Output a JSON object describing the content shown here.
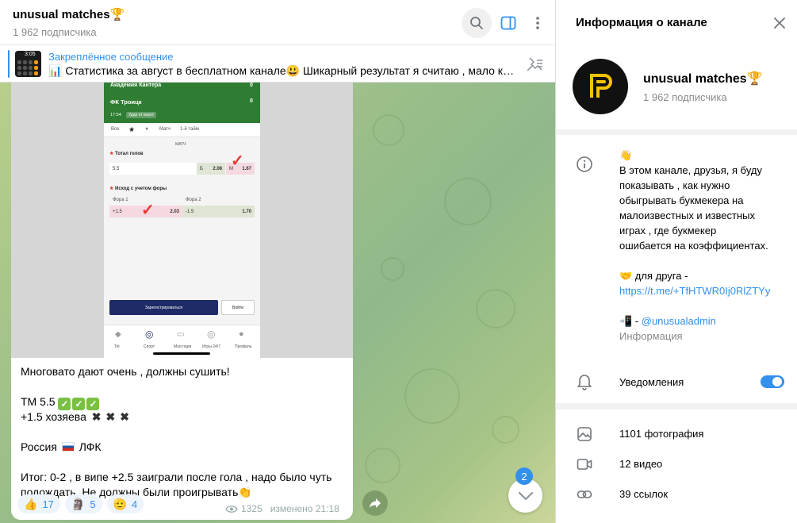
{
  "header": {
    "channel_title": "unusual matches🏆",
    "subscribers": "1 962 подписчика",
    "icons": [
      "search-icon",
      "sidebar-toggle-icon",
      "more-vertical-icon"
    ]
  },
  "pinned": {
    "title": "Закреплённое сообщение",
    "text": "📊 Статистика за август в бесплатном канале😃  Шикарный результат я считаю , мало кто ...",
    "icon": "unpin-icon",
    "thumb_time": "3:05"
  },
  "screenshot": {
    "team1": "Академия Кантера",
    "team1_score": "0",
    "team2": "ФК Троицк",
    "team2_score": "0",
    "time": "17:54",
    "event": "Удар от ворот",
    "tabs": [
      "Все",
      "Матч",
      "1-й тайм"
    ],
    "match_label": "МАТЧ",
    "total_title": "Тотал голов",
    "total_line": "5.5",
    "total_b_label": "Б",
    "total_b_odds": "2.08",
    "total_m_label": "М",
    "total_m_odds": "1.67",
    "handicap_title": "Исход с учетом форы",
    "fora1_label": "Фора 1",
    "fora2_label": "Фора 2",
    "fora1_line": "+1.5",
    "fora1_odds": "2.03",
    "fora2_line": "-1.5",
    "fora2_odds": "1.70",
    "register_label": "Зарегистрироваться",
    "login_label": "Войти",
    "nav": [
      "Tot",
      "Спорт",
      "Мои пари",
      "Игры 24/7",
      "Профиль"
    ]
  },
  "message": {
    "line1": "Многовато дают очень , должны сушить!",
    "line2_text": "ТМ 5.5",
    "line3_text": "+1.5 хозяева",
    "line4_left": "Россия",
    "line4_right": "ЛФК",
    "line5": "Итог: 0-2 , в випе +2.5 заиграли после гола , надо было чуть",
    "line6": "подождать. Не должны были проигрывать",
    "views": "1325",
    "edited": "изменено 21:18"
  },
  "reactions": [
    {
      "emoji": "👍",
      "count": "17"
    },
    {
      "emoji": "🗿",
      "count": "5"
    },
    {
      "emoji": "🫡",
      "count": "4"
    }
  ],
  "scroll_badge": "2",
  "info": {
    "title": "Информация о канале",
    "name": "unusual matches🏆",
    "subscribers": "1 962 подписчика",
    "desc": [
      "👋",
      "В этом канале, друзья, я буду",
      "показывать , как нужно",
      "обыгрывать букмекера на",
      "малоизвестных и известных",
      "играх , где букмекер",
      "ошибается на коэффициентах."
    ],
    "friend_prefix": "🤝 для друга -",
    "friend_link": "https://t.me/+TfHTWR0Ij0RlZTYy",
    "admin_prefix": "📲 - ",
    "admin_link": "@unusualadmin",
    "info_label": "Информация",
    "notifications": "Уведомления",
    "notifications_on": true,
    "photos": "1101 фотография",
    "videos": "12 видео",
    "links": "39 ссылок"
  },
  "colors": {
    "accent": "#3390ec",
    "green_check": "#7ac143",
    "pitch": "#2e7d32"
  }
}
